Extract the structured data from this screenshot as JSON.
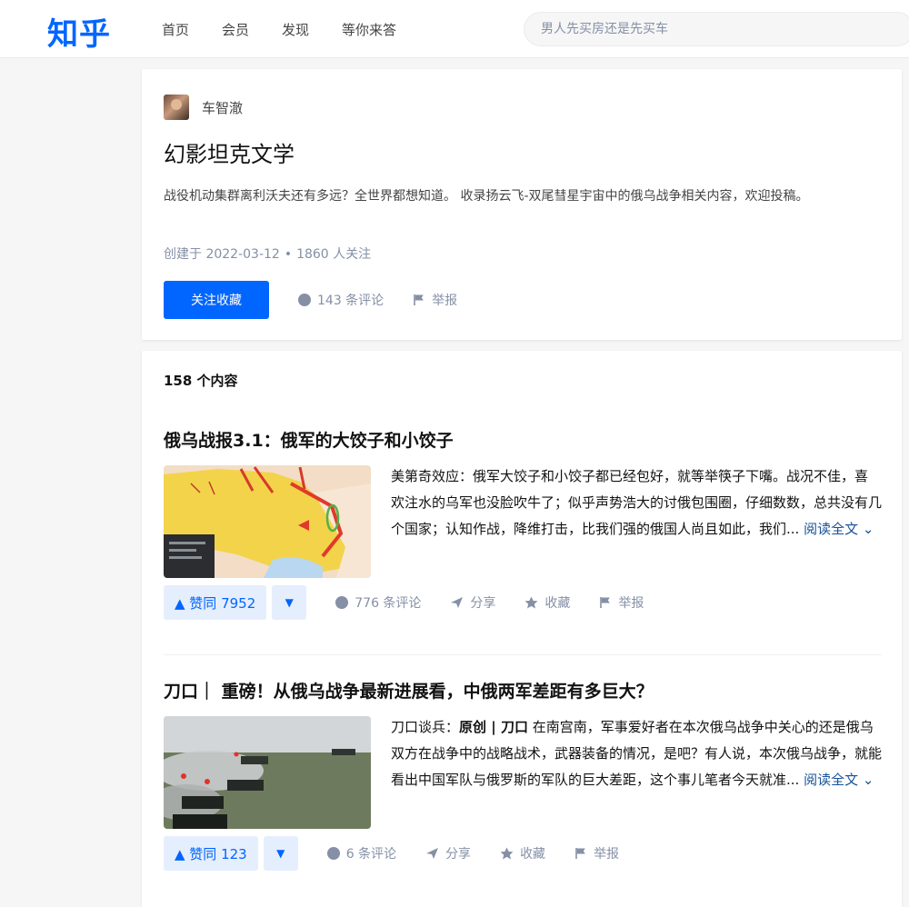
{
  "header": {
    "logo": "知乎",
    "nav": [
      "首页",
      "会员",
      "发现",
      "等你来答"
    ],
    "search_placeholder": "男人先买房还是先买车"
  },
  "collection": {
    "author": "车智澈",
    "title": "幻影坦克文学",
    "description": "战役机动集群离利沃夫还有多远？全世界都想知道。 收录扬云飞-双尾彗星宇宙中的俄乌战争相关内容，欢迎投稿。",
    "meta_created": "创建于 2022-03-12",
    "meta_followers": "1860 人关注",
    "follow_label": "关注收藏",
    "comments_label": "143 条评论",
    "report_label": "举报"
  },
  "list": {
    "count_label": "158 个内容",
    "items": [
      {
        "title": "俄乌战报3.1：俄军的大饺子和小饺子",
        "author_prefix": "美第奇效应：",
        "excerpt": "俄军大饺子和小饺子都已经包好，就等举筷子下嘴。战况不佳，喜欢注水的乌军也没脸吹牛了；似乎声势浩大的讨俄包围圈，仔细数数，总共没有几个国家；认知作战，降维打击，比我们强的俄国人尚且如此，我们...",
        "read_more": "阅读全文 ⌄",
        "vote_label": "▲ 赞同 7952",
        "comments": "776 条评论",
        "share": "分享",
        "favorite": "收藏",
        "report": "举报"
      },
      {
        "title": "刀口｜ 重磅！从俄乌战争最新进展看，中俄两军差距有多巨大？",
        "author_prefix": "刀口谈兵：",
        "excerpt_bold": "原创 | 刀口",
        "excerpt": " 在南宫南，军事爱好者在本次俄乌战争中关心的还是俄乌双方在战争中的战略战术，武器装备的情况，是吧？有人说，本次俄乌战争，就能看出中国军队与俄罗斯的军队的巨大差距，这个事儿笔者今天就准...",
        "read_more": "阅读全文 ⌄",
        "vote_label": "▲ 赞同 123",
        "comments": "6 条评论",
        "share": "分享",
        "favorite": "收藏",
        "report": "举报"
      }
    ]
  },
  "colors": {
    "brand": "#0066ff",
    "muted": "#8590a6",
    "link": "#175199",
    "vote_bg": "#e5eefc"
  },
  "icons": [
    "comment-icon",
    "report-flag-icon",
    "share-icon",
    "star-icon",
    "vote-down-icon"
  ]
}
